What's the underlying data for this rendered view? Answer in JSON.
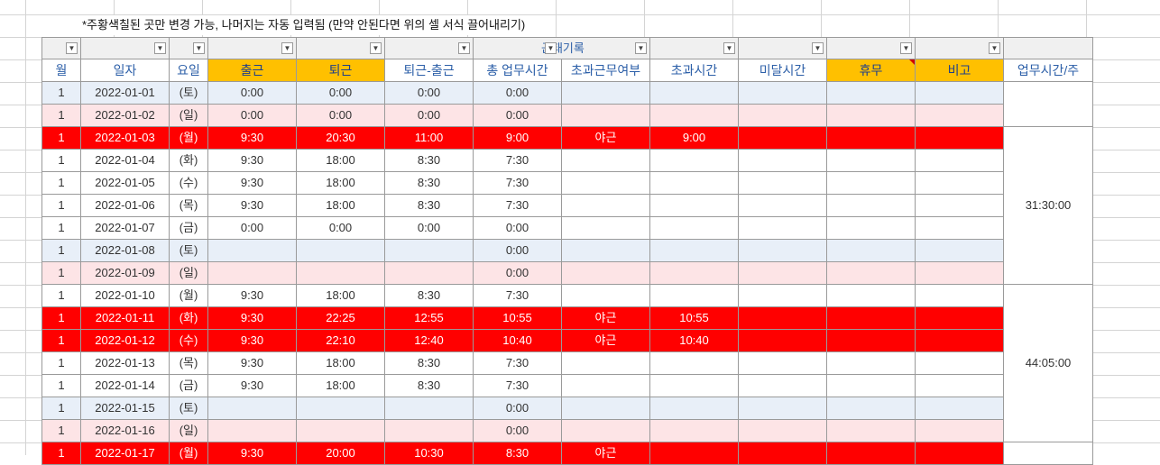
{
  "note": "*주황색칠된 곳만 변경 가능, 나머지는 자동 입력됨 (만약 안된다면 위의 셀 서식 끌어내리기)",
  "group_title": "근태기록",
  "headers": [
    "월",
    "일자",
    "요일",
    "출근",
    "퇴근",
    "퇴근-출근",
    "총 업무시간",
    "초과근무여부",
    "초과시간",
    "미달시간",
    "휴무",
    "비고",
    "업무시간/주"
  ],
  "rows": [
    {
      "month": "1",
      "date": "2022-01-01",
      "day": "(토)",
      "in": "0:00",
      "out": "0:00",
      "diff": "0:00",
      "total": "0:00",
      "ot_flag": "",
      "ot": "",
      "short": "",
      "off": "",
      "memo": ""
    },
    {
      "month": "1",
      "date": "2022-01-02",
      "day": "(일)",
      "in": "0:00",
      "out": "0:00",
      "diff": "0:00",
      "total": "0:00",
      "ot_flag": "",
      "ot": "",
      "short": "",
      "off": "",
      "memo": ""
    },
    {
      "month": "1",
      "date": "2022-01-03",
      "day": "(월)",
      "in": "9:30",
      "out": "20:30",
      "diff": "11:00",
      "total": "9:00",
      "ot_flag": "야근",
      "ot": "9:00",
      "short": "",
      "off": "",
      "memo": ""
    },
    {
      "month": "1",
      "date": "2022-01-04",
      "day": "(화)",
      "in": "9:30",
      "out": "18:00",
      "diff": "8:30",
      "total": "7:30",
      "ot_flag": "",
      "ot": "",
      "short": "",
      "off": "",
      "memo": ""
    },
    {
      "month": "1",
      "date": "2022-01-05",
      "day": "(수)",
      "in": "9:30",
      "out": "18:00",
      "diff": "8:30",
      "total": "7:30",
      "ot_flag": "",
      "ot": "",
      "short": "",
      "off": "",
      "memo": ""
    },
    {
      "month": "1",
      "date": "2022-01-06",
      "day": "(목)",
      "in": "9:30",
      "out": "18:00",
      "diff": "8:30",
      "total": "7:30",
      "ot_flag": "",
      "ot": "",
      "short": "",
      "off": "",
      "memo": ""
    },
    {
      "month": "1",
      "date": "2022-01-07",
      "day": "(금)",
      "in": "0:00",
      "out": "0:00",
      "diff": "0:00",
      "total": "0:00",
      "ot_flag": "",
      "ot": "",
      "short": "",
      "off": "",
      "memo": ""
    },
    {
      "month": "1",
      "date": "2022-01-08",
      "day": "(토)",
      "in": "",
      "out": "",
      "diff": "",
      "total": "0:00",
      "ot_flag": "",
      "ot": "",
      "short": "",
      "off": "",
      "memo": ""
    },
    {
      "month": "1",
      "date": "2022-01-09",
      "day": "(일)",
      "in": "",
      "out": "",
      "diff": "",
      "total": "0:00",
      "ot_flag": "",
      "ot": "",
      "short": "",
      "off": "",
      "memo": ""
    },
    {
      "month": "1",
      "date": "2022-01-10",
      "day": "(월)",
      "in": "9:30",
      "out": "18:00",
      "diff": "8:30",
      "total": "7:30",
      "ot_flag": "",
      "ot": "",
      "short": "",
      "off": "",
      "memo": ""
    },
    {
      "month": "1",
      "date": "2022-01-11",
      "day": "(화)",
      "in": "9:30",
      "out": "22:25",
      "diff": "12:55",
      "total": "10:55",
      "ot_flag": "야근",
      "ot": "10:55",
      "short": "",
      "off": "",
      "memo": ""
    },
    {
      "month": "1",
      "date": "2022-01-12",
      "day": "(수)",
      "in": "9:30",
      "out": "22:10",
      "diff": "12:40",
      "total": "10:40",
      "ot_flag": "야근",
      "ot": "10:40",
      "short": "",
      "off": "",
      "memo": ""
    },
    {
      "month": "1",
      "date": "2022-01-13",
      "day": "(목)",
      "in": "9:30",
      "out": "18:00",
      "diff": "8:30",
      "total": "7:30",
      "ot_flag": "",
      "ot": "",
      "short": "",
      "off": "",
      "memo": ""
    },
    {
      "month": "1",
      "date": "2022-01-14",
      "day": "(금)",
      "in": "9:30",
      "out": "18:00",
      "diff": "8:30",
      "total": "7:30",
      "ot_flag": "",
      "ot": "",
      "short": "",
      "off": "",
      "memo": ""
    },
    {
      "month": "1",
      "date": "2022-01-15",
      "day": "(토)",
      "in": "",
      "out": "",
      "diff": "",
      "total": "0:00",
      "ot_flag": "",
      "ot": "",
      "short": "",
      "off": "",
      "memo": ""
    },
    {
      "month": "1",
      "date": "2022-01-16",
      "day": "(일)",
      "in": "",
      "out": "",
      "diff": "",
      "total": "0:00",
      "ot_flag": "",
      "ot": "",
      "short": "",
      "off": "",
      "memo": ""
    },
    {
      "month": "1",
      "date": "2022-01-17",
      "day": "(월)",
      "in": "9:30",
      "out": "20:00",
      "diff": "10:30",
      "total": "8:30",
      "ot_flag": "야근",
      "ot": "",
      "short": "",
      "off": "",
      "memo": ""
    }
  ],
  "weekly_totals": [
    "",
    "31:30:00",
    "44:05:00",
    ""
  ],
  "colors": {
    "red_row": "#ff0000",
    "saturday": "#e8eff8",
    "sunday": "#fde4e6",
    "input_header": "#ffc000",
    "header_text": "#2c5fa8"
  }
}
